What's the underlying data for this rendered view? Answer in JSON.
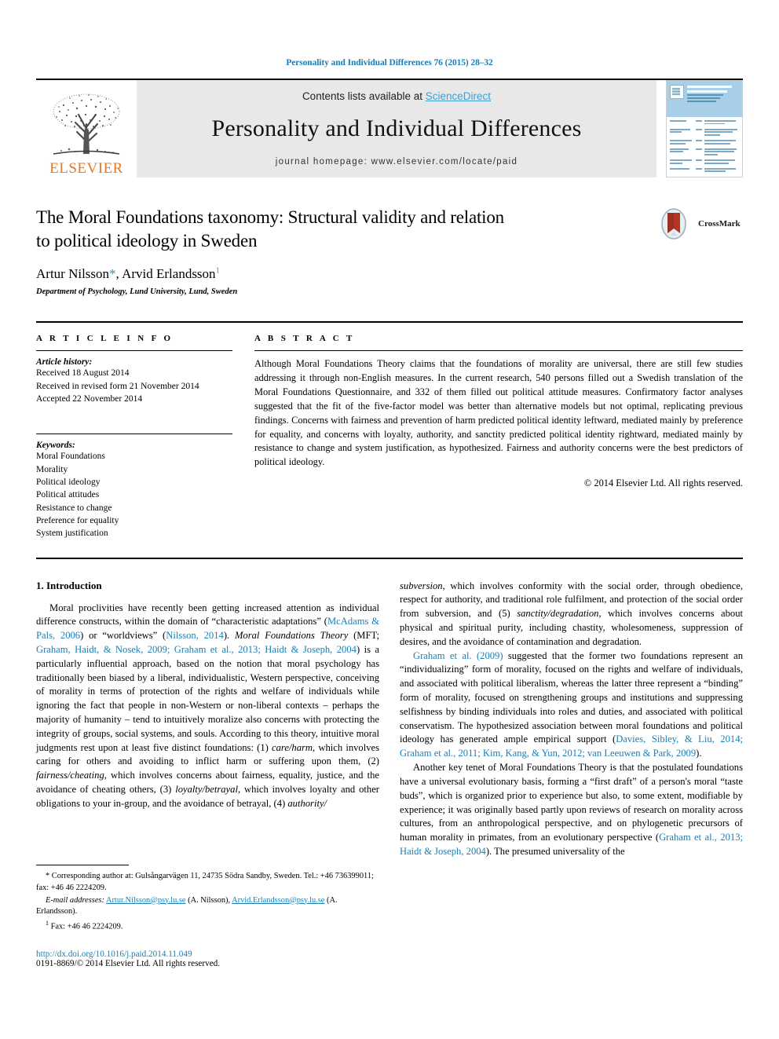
{
  "running_head": "Personality and Individual Differences 76 (2015) 28–32",
  "masthead": {
    "publisher_name": "ELSEVIER",
    "contents_prefix": "Contents lists available at ",
    "sciencedirect": "ScienceDirect",
    "journal_name": "Personality and Individual Differences",
    "homepage": "journal homepage: www.elsevier.com/locate/paid",
    "cover_title_line1": "PERSONALITY AND",
    "cover_title_line2": "INDIVIDUAL DIFFERENCES"
  },
  "title": {
    "line1": "The Moral Foundations taxonomy: Structural validity and relation",
    "line2": "to political ideology in Sweden",
    "crossmark_label": "CrossMark"
  },
  "authors": {
    "author1": "Artur Nilsson",
    "star": "*",
    "separator": ", ",
    "author2": "Arvid Erlandsson",
    "footnote_marker": "1",
    "affiliation": "Department of Psychology, Lund University, Lund, Sweden"
  },
  "article_info": {
    "heading": "A R T I C L E   I N F O",
    "history_label": "Article history:",
    "history": [
      "Received 18 August 2014",
      "Received in revised form 21 November 2014",
      "Accepted 22 November 2014"
    ],
    "keywords_label": "Keywords:",
    "keywords": [
      "Moral Foundations",
      "Morality",
      "Political ideology",
      "Political attitudes",
      "Resistance to change",
      "Preference for equality",
      "System justification"
    ]
  },
  "abstract": {
    "heading": "A B S T R A C T",
    "text": "Although Moral Foundations Theory claims that the foundations of morality are universal, there are still few studies addressing it through non-English measures. In the current research, 540 persons filled out a Swedish translation of the Moral Foundations Questionnaire, and 332 of them filled out political attitude measures. Confirmatory factor analyses suggested that the fit of the five-factor model was better than alternative models but not optimal, replicating previous findings. Concerns with fairness and prevention of harm predicted political identity leftward, mediated mainly by preference for equality, and concerns with loyalty, authority, and sanctity predicted political identity rightward, mediated mainly by resistance to change and system justification, as hypothesized. Fairness and authority concerns were the best predictors of political ideology.",
    "copyright": "© 2014 Elsevier Ltd. All rights reserved."
  },
  "introduction": {
    "section_title": "1. Introduction",
    "left_para1": {
      "s1": "Moral proclivities have recently been getting increased attention as individual difference constructs, within the domain of “characteristic adaptations” (",
      "r1": "McAdams & Pals, 2006",
      "s2": ") or “worldviews” (",
      "r2": "Nilsson, 2014",
      "s3": "). ",
      "i1": "Moral Foundations Theory",
      "s4": " (MFT; ",
      "r3": "Graham, Haidt, & Nosek, 2009; Graham et al., 2013; Haidt & Joseph, 2004",
      "s5": ") is a particularly influential approach, based on the notion that moral psychology has traditionally been biased by a liberal, individualistic, Western perspective, conceiving of morality in terms of protection of the rights and welfare of individuals while ignoring the fact that people in non-Western or non-liberal contexts – perhaps the majority of humanity – tend to intuitively moralize also concerns with protecting the integrity of groups, social systems, and souls. According to this theory, intuitive moral judgments rest upon at least five distinct foundations: (1) ",
      "i2": "care/harm",
      "s6": ", which involves caring for others and avoiding to inflict harm or suffering upon them, (2) ",
      "i3": "fairness/cheating",
      "s7": ", which involves concerns about fairness, equality, justice, and the avoidance of cheating others, (3) ",
      "i4": "loyalty/betrayal",
      "s8": ", which involves loyalty and other obligations to your in-group, and the avoidance of betrayal, (4) ",
      "i5": "authority/"
    },
    "right_para1_cont": {
      "i1": "subversion",
      "s1": ", which involves conformity with the social order, through obedience, respect for authority, and traditional role fulfilment, and protection of the social order from subversion, and (5) ",
      "i2": "sanctity/degradation",
      "s2": ", which involves concerns about physical and spiritual purity, including chastity, wholesomeness, suppression of desires, and the avoidance of contamination and degradation."
    },
    "right_para2": {
      "r1": "Graham et al. (2009)",
      "s1": " suggested that the former two foundations represent an “individualizing” form of morality, focused on the rights and welfare of individuals, and associated with political liberalism, whereas the latter three represent a “binding” form of morality, focused on strengthening groups and institutions and suppressing selfishness by binding individuals into roles and duties, and associated with political conservatism. The hypothesized association between moral foundations and political ideology has generated ample empirical support (",
      "r2": "Davies, Sibley, & Liu, 2014; Graham et al., 2011; Kim, Kang, & Yun, 2012; van Leeuwen & Park, 2009",
      "s2": ")."
    },
    "right_para3": {
      "s1": "Another key tenet of Moral Foundations Theory is that the postulated foundations have a universal evolutionary basis, forming a “first draft” of a person's moral “taste buds”, which is organized prior to experience but also, to some extent, modifiable by experience; it was originally based partly upon reviews of research on morality across cultures, from an anthropological perspective, and on phylogenetic precursors of human morality in primates, from an evolutionary perspective (",
      "r1": "Graham et al., 2013; Haidt & Joseph, 2004",
      "s2": "). The presumed universality of the"
    }
  },
  "footnotes": {
    "corresponding_marker": "*",
    "corresponding": " Corresponding author at: Gulsångarvägen 11, 24735 Södra Sandby, Sweden. Tel.: +46 736399011; fax: +46 46 2224209.",
    "email_label": "E-mail addresses:",
    "email1": "Artur.Nilsson@psy.lu.se",
    "email1_owner": " (A. Nilsson), ",
    "email2": "Arvid.Erlandsson@psy.lu.se",
    "email2_owner": " (A. Erlandsson).",
    "fn1_marker": "1",
    "fn1": " Fax: +46 46 2224209.",
    "doi": "http://dx.doi.org/10.1016/j.paid.2014.11.049",
    "issn": "0191-8869/© 2014 Elsevier Ltd. All rights reserved."
  },
  "colors": {
    "link": "#1a7eb5",
    "elsevier_orange": "#e87722",
    "sciencedirect": "#3c9fd6",
    "masthead_bg": "#e8e8e8"
  }
}
